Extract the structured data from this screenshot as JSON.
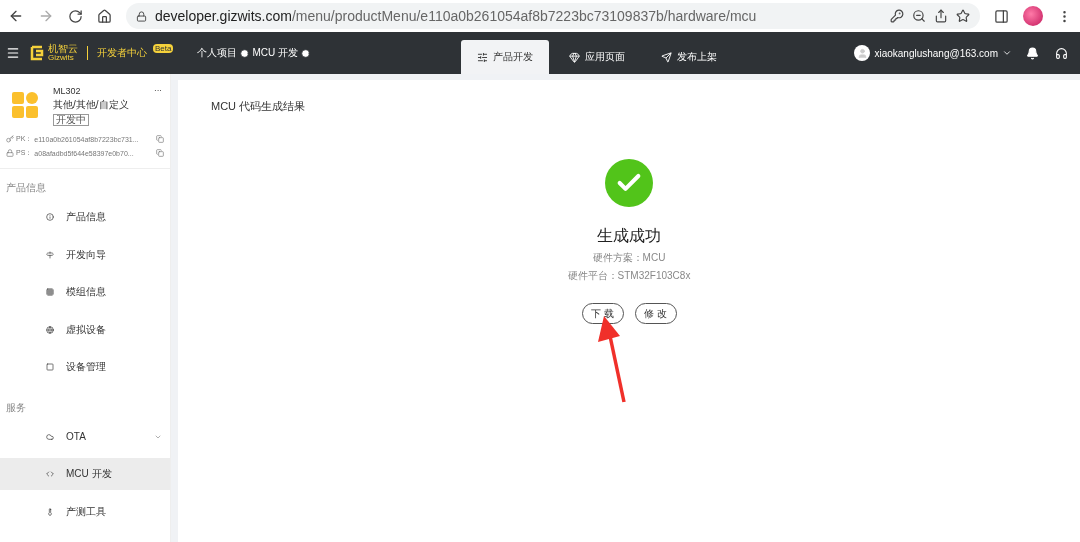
{
  "browser": {
    "url_host": "developer.gizwits.com",
    "url_path": "/menu/productMenu/e110a0b261054af8b7223bc73109837b/hardware/mcu"
  },
  "header": {
    "logo_cn": "机智云",
    "logo_en": "Gizwits",
    "portal": "开发者中心",
    "portal_badge": "Beta",
    "breadcrumbs": [
      "个人项目",
      "MCU 开发"
    ],
    "tabs": [
      {
        "label": "产品开发",
        "selected": true
      },
      {
        "label": "应用页面",
        "selected": false
      },
      {
        "label": "发布上架",
        "selected": false
      }
    ],
    "user": "xiaokanglushang@163.com"
  },
  "product": {
    "name": "ML302",
    "category": "其他/其他/自定义",
    "status": "开发中",
    "more": "···",
    "pk_label": "PK：",
    "pk": "e110a0b261054af8b7223bc731...",
    "ps_label": "PS：",
    "ps": "a08afadbd5f644e58397e0b70..."
  },
  "sidebar": [
    {
      "heading": "产品信息",
      "items": [
        {
          "label": "产品信息",
          "selected": false
        },
        {
          "label": "开发向导",
          "selected": false
        },
        {
          "label": "模组信息",
          "selected": false
        },
        {
          "label": "虚拟设备",
          "selected": false
        },
        {
          "label": "设备管理",
          "selected": false
        }
      ]
    },
    {
      "heading": "服务",
      "items": [
        {
          "label": "OTA",
          "selected": false,
          "expanded": false
        },
        {
          "label": "MCU 开发",
          "selected": true
        },
        {
          "label": "产测工具",
          "selected": false
        }
      ]
    }
  ],
  "main": {
    "title": "MCU 代码生成结果",
    "result": "生成成功",
    "details": [
      "硬件方案：MCU",
      "硬件平台：STM32F103C8x"
    ],
    "buttons": [
      "下 载",
      "修 改"
    ]
  }
}
